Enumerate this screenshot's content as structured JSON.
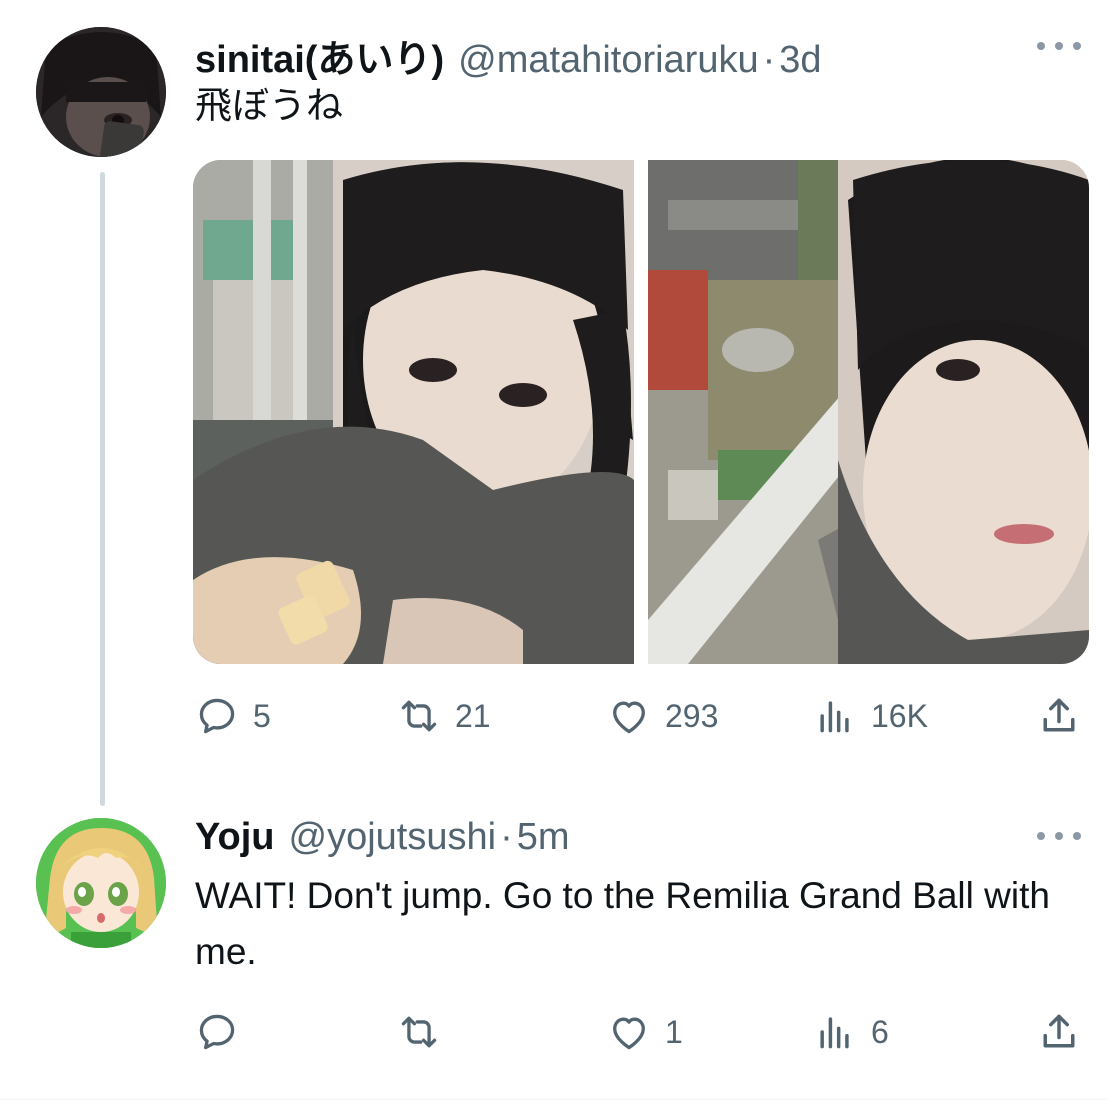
{
  "tweets": [
    {
      "display_name": "sinitai(あいり)",
      "handle": "@matahitoriaruku",
      "separator": "·",
      "time": "3d",
      "text": "飛ぼうね",
      "media_count": 2,
      "stats": {
        "replies": "5",
        "reposts": "21",
        "likes": "293",
        "views": "16K"
      }
    },
    {
      "display_name": "Yoju",
      "handle": "@yojutsushi",
      "separator": "·",
      "time": "5m",
      "text": "WAIT! Don't jump. Go to the Remilia Grand Ball with me.",
      "stats": {
        "replies": "",
        "reposts": "",
        "likes": "1",
        "views": "6"
      }
    }
  ],
  "icons": {
    "more": "more-horizontal-icon",
    "reply": "reply-icon",
    "repost": "repost-icon",
    "like": "heart-icon",
    "views": "views-chart-icon",
    "share": "share-icon"
  },
  "colors": {
    "text": "#0f1419",
    "secondary": "#536471",
    "thread_line": "#cfd9de",
    "background": "#ffffff"
  }
}
